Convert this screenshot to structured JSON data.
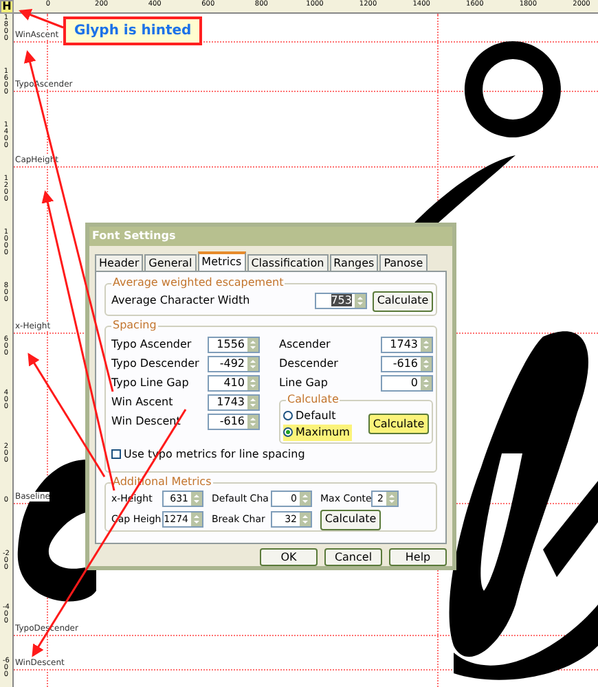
{
  "hint_badge": "H",
  "callout": "Glyph is hinted",
  "ruler": {
    "x_labels": [
      "0",
      "200",
      "400",
      "600",
      "800",
      "1000",
      "1200",
      "1400",
      "1600",
      "1800",
      "2000"
    ],
    "y_labels": [
      "1800",
      "1600",
      "1400",
      "1200",
      "1000",
      "800",
      "600",
      "400",
      "200",
      "0",
      "-200",
      "-400",
      "-600"
    ]
  },
  "guides": [
    {
      "label": "WinAscent"
    },
    {
      "label": "TypoAscender"
    },
    {
      "label": "CapHeight"
    },
    {
      "label": "x-Height"
    },
    {
      "label": "Baseline"
    },
    {
      "label": "TypoDescender"
    },
    {
      "label": "WinDescent"
    }
  ],
  "dialog": {
    "title": "Font Settings",
    "tabs": [
      {
        "label": "Header",
        "selected": false
      },
      {
        "label": "General",
        "selected": false
      },
      {
        "label": "Metrics",
        "selected": true
      },
      {
        "label": "Classification",
        "selected": false
      },
      {
        "label": "Ranges",
        "selected": false
      },
      {
        "label": "Panose",
        "selected": false
      }
    ],
    "escapement": {
      "legend": "Average weighted escapement",
      "label": "Average Character Width",
      "value": "753",
      "button": "Calculate"
    },
    "spacing": {
      "legend": "Spacing",
      "left": [
        {
          "label": "Typo Ascender",
          "value": "1556"
        },
        {
          "label": "Typo Descender",
          "value": "-492"
        },
        {
          "label": "Typo Line Gap",
          "value": "410"
        },
        {
          "label": "Win Ascent",
          "value": "1743"
        },
        {
          "label": "Win Descent",
          "value": "-616"
        }
      ],
      "right": [
        {
          "label": "Ascender",
          "value": "1743"
        },
        {
          "label": "Descender",
          "value": "-616"
        },
        {
          "label": "Line Gap",
          "value": "0"
        }
      ],
      "calculate": {
        "legend": "Calculate",
        "options": [
          {
            "label": "Default",
            "selected": false
          },
          {
            "label": "Maximum",
            "selected": true
          }
        ],
        "button": "Calculate"
      },
      "checkbox": {
        "label": "Use typo metrics for line spacing",
        "checked": false
      }
    },
    "additional": {
      "legend": "Additional Metrics",
      "rows": [
        [
          {
            "label": "x-Height",
            "value": "631"
          },
          {
            "label": "Default Cha",
            "value": "0"
          },
          {
            "label": "Max Conte",
            "value": "2"
          }
        ],
        [
          {
            "label": "Cap Heigh",
            "value": "1274"
          },
          {
            "label": "Break Char",
            "value": "32"
          }
        ]
      ],
      "button": "Calculate"
    },
    "buttons": [
      "OK",
      "Cancel",
      "Help"
    ]
  }
}
